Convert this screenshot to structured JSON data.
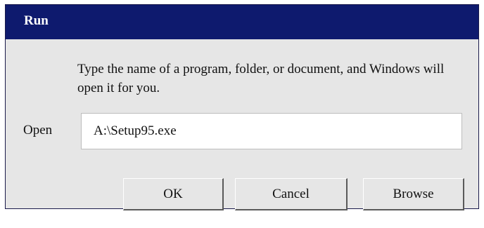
{
  "window": {
    "title": "Run"
  },
  "dialog": {
    "description": "Type the name of a program, folder, or document, and Windows will open it for you.",
    "open_label": "Open",
    "open_value": "A:\\Setup95.exe"
  },
  "buttons": {
    "ok": "OK",
    "cancel": "Cancel",
    "browse": "Browse"
  },
  "colors": {
    "titlebar": "#0e1a6e",
    "dialog_bg": "#e6e6e6"
  }
}
